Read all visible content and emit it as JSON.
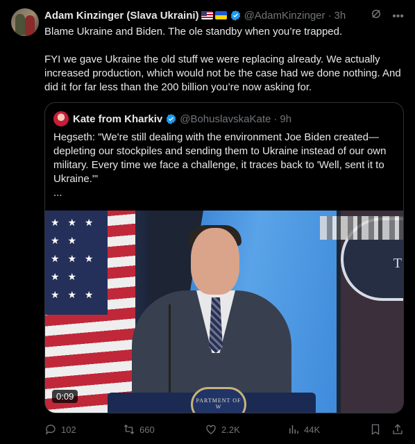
{
  "tweet": {
    "display_name": "Adam Kinzinger (Slava Ukraini)",
    "handle": "@AdamKinzinger",
    "separator": "·",
    "time": "3h",
    "paragraphs": [
      "Blame Ukraine and Biden.  The ole standby when you’re trapped.",
      "FYI we gave Ukraine the old stuff we were replacing already.  We actually increased production, which would not be the case had we done nothing.  And did it for far less than the 200 billion you’re now asking for."
    ]
  },
  "quote": {
    "display_name": "Kate from Kharkiv",
    "handle": "@BohuslavskaKate",
    "separator": "·",
    "time": "9h",
    "text": "Hegseth: \"We're still dealing with the environment Joe Biden created—depleting our stockpiles and sending them to Ukraine instead of our own military. Every time we face a challenge, it traces back to 'Well, sent it to Ukraine.'\"",
    "ellipsis": "...",
    "video": {
      "duration": "0:09",
      "seal_letter": "T",
      "podium_seal_text": "PARTMENT OF W"
    }
  },
  "actions": {
    "replies": "102",
    "reposts": "660",
    "likes": "2.2K",
    "views": "44K"
  },
  "colors": {
    "background": "#000000",
    "text": "#e7e9ea",
    "muted": "#71767b",
    "verified": "#1d9bf0",
    "border": "#2f3336"
  },
  "icons": [
    "grok-icon",
    "more-icon",
    "verified-icon",
    "reply-icon",
    "repost-icon",
    "like-icon",
    "views-icon",
    "bookmark-icon",
    "share-icon"
  ]
}
